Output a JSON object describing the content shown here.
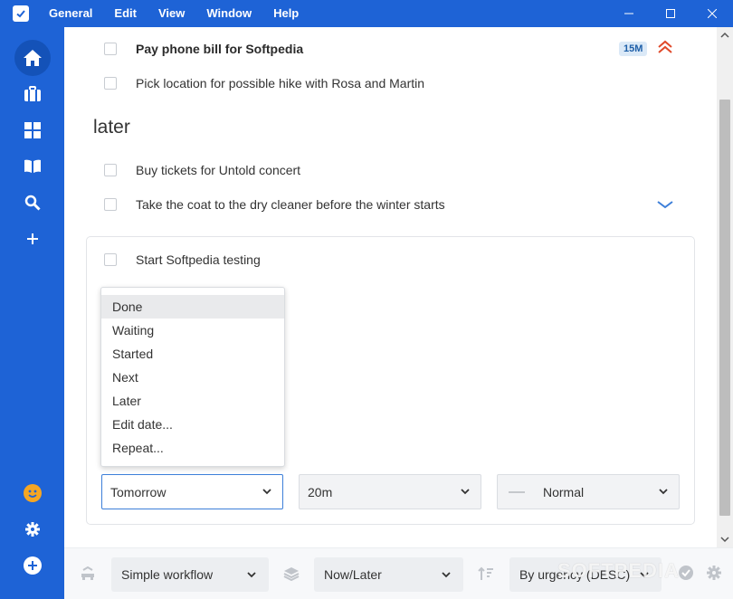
{
  "menu": [
    "General",
    "Edit",
    "View",
    "Window",
    "Help"
  ],
  "tasks_top": [
    {
      "title": "Pay phone bill for Softpedia",
      "bold": true,
      "badge": "15M"
    },
    {
      "title": "Pick location for possible hike with Rosa and Martin",
      "bold": false
    }
  ],
  "section": {
    "title": "later"
  },
  "tasks_later": [
    {
      "title": "Buy tickets for Untold concert"
    },
    {
      "title": "Take the coat to the dry cleaner before the winter starts"
    }
  ],
  "editing_task": {
    "title": "Start Softpedia testing"
  },
  "dropdown": {
    "items": [
      "Done",
      "Waiting",
      "Started",
      "Next",
      "Later",
      "Edit date...",
      "Repeat..."
    ],
    "highlighted": "Done"
  },
  "fields": {
    "date": "Tomorrow",
    "duration": "20m",
    "priority": "Normal"
  },
  "bottom": {
    "workflow": "Simple workflow",
    "view": "Now/Later",
    "sort": "By urgency (DESC)"
  },
  "watermark": "SOFTPEDIA",
  "colors": {
    "accent": "#1e63d6",
    "sidebar_active": "#1452b8",
    "urgency": "#e04a2a",
    "user_icon": "#f5a623",
    "badge_bg": "#dbe9f7",
    "badge_text": "#1e5fa8"
  }
}
